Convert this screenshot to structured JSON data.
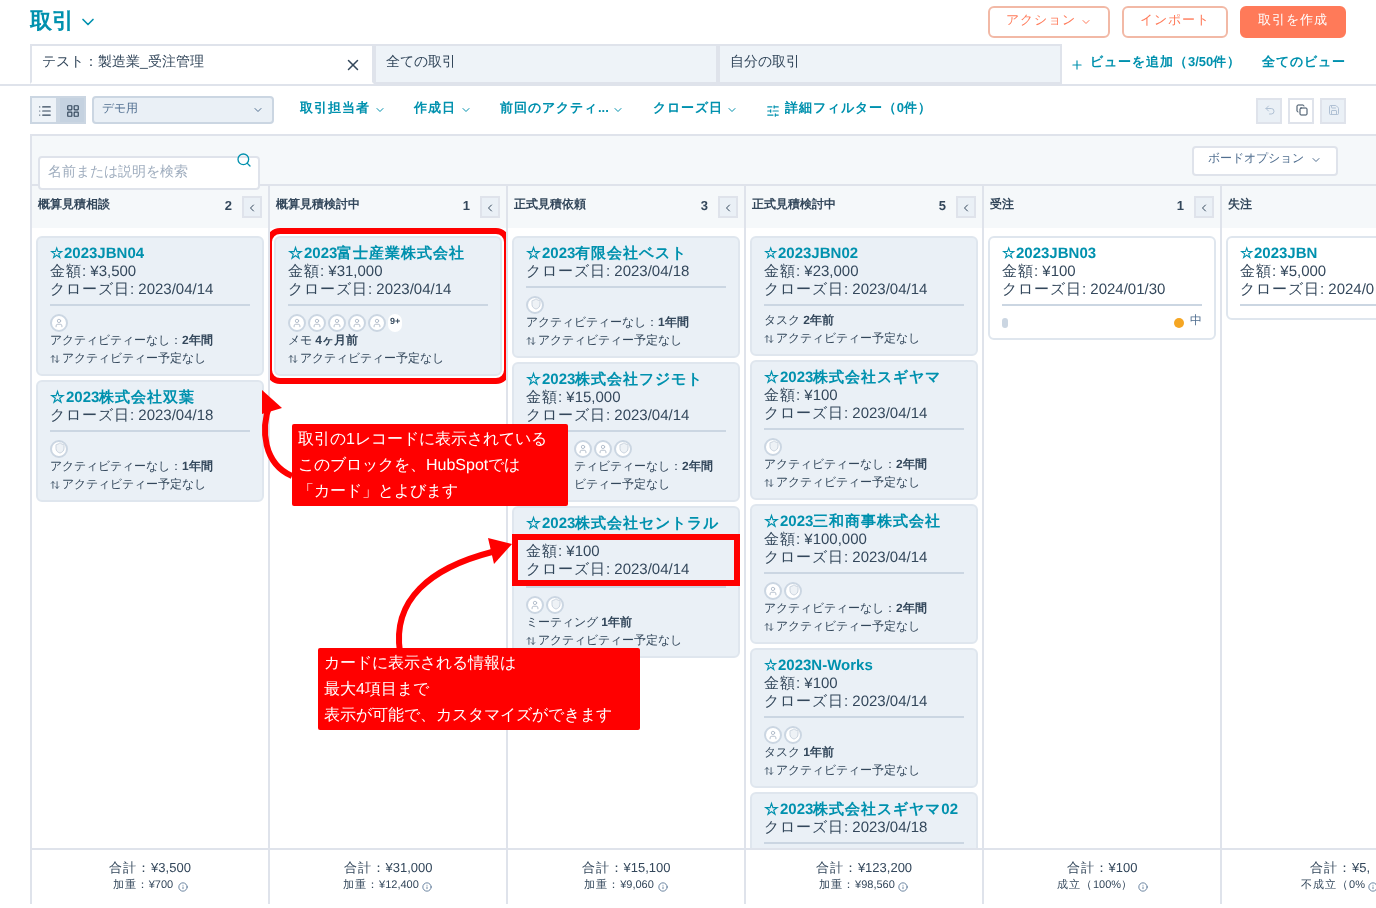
{
  "header": {
    "title": "取引",
    "buttons": [
      {
        "label": "アクション",
        "kind": "menu"
      },
      {
        "label": "インポート",
        "kind": "outline"
      },
      {
        "label": "取引を作成",
        "kind": "primary"
      }
    ]
  },
  "tabs": [
    {
      "label": "テスト：製造業_受注管理",
      "selected": true,
      "closable": true
    },
    {
      "label": "全ての取引",
      "selected": false,
      "closable": false
    },
    {
      "label": "自分の取引",
      "selected": false,
      "closable": false
    }
  ],
  "add_view": "ビューを追加（3/50件）",
  "all_views": "全てのビュー",
  "view_toggle": [
    {
      "kind": "list",
      "selected": false
    },
    {
      "kind": "grid",
      "selected": true
    }
  ],
  "pipeline": "デモ用",
  "filters": [
    {
      "label": "取引担当者",
      "kind": "dropdown"
    },
    {
      "label": "作成日",
      "kind": "dropdown"
    },
    {
      "label": "前回のアクティ...",
      "kind": "dropdown"
    },
    {
      "label": "クローズ日",
      "kind": "dropdown"
    },
    {
      "label": "詳細フィルター（0件）",
      "kind": "advanced"
    }
  ],
  "search": {
    "placeholder": "名前または説明を検索"
  },
  "board_options": "ボードオプション",
  "columns": [
    {
      "name": "概算見積相談",
      "count": "2",
      "total": "合計：¥3,500",
      "sub": "加重：¥700",
      "cards": [
        {
          "title": "☆2023JBN04",
          "lines": [
            "金額: ¥3,500",
            "クローズ日: 2023/04/14"
          ],
          "highlighted": true,
          "avatars": [
            {
              "kind": "person"
            }
          ],
          "activity": [
            {
              "kind": "text",
              "text": "アクティビティーなし：**2年間**"
            },
            {
              "kind": "upcoming",
              "text": "アクティビティー予定なし"
            }
          ]
        },
        {
          "title": "☆2023株式会社双葉",
          "lines": [
            "クローズ日: 2023/04/18"
          ],
          "highlighted": true,
          "avatars": [
            {
              "kind": "shield"
            }
          ],
          "activity": [
            {
              "kind": "text",
              "text": "アクティビティーなし：**1年間**"
            },
            {
              "kind": "upcoming",
              "text": "アクティビティー予定なし"
            }
          ]
        }
      ]
    },
    {
      "name": "概算見積検討中",
      "count": "1",
      "total": "合計：¥31,000",
      "sub": "加重：¥12,400",
      "cards": [
        {
          "title": "☆2023富士産業株式会社",
          "lines": [
            "金額: ¥31,000",
            "クローズ日: 2023/04/14"
          ],
          "highlighted": true,
          "outlined": true,
          "avatars": [
            {
              "kind": "person"
            },
            {
              "kind": "person"
            },
            {
              "kind": "person"
            },
            {
              "kind": "person"
            },
            {
              "kind": "person"
            }
          ],
          "more": "9+",
          "activity": [
            {
              "kind": "text",
              "text": "メモ **4ヶ月前**"
            },
            {
              "kind": "upcoming",
              "text": "アクティビティー予定なし"
            }
          ]
        }
      ]
    },
    {
      "name": "正式見積依頼",
      "count": "3",
      "total": "合計：¥15,100",
      "sub": "加重：¥9,060",
      "cards": [
        {
          "title": "☆2023有限会社ベスト",
          "lines": [
            "クローズ日: 2023/04/18"
          ],
          "highlighted": true,
          "avatars": [
            {
              "kind": "shield"
            }
          ],
          "activity": [
            {
              "kind": "text",
              "text": "アクティビティーなし：**1年間**"
            },
            {
              "kind": "upcoming",
              "text": "アクティビティー予定なし"
            }
          ]
        },
        {
          "title": "☆2023株式会社フジモト",
          "lines": [
            "金額: ¥15,000",
            "クローズ日: 2023/04/14"
          ],
          "highlighted": true,
          "covered": true,
          "avatars": [
            {
              "kind": "person"
            },
            {
              "kind": "person"
            },
            {
              "kind": "shield"
            }
          ],
          "activity": [
            {
              "kind": "text",
              "text": "ティビティーなし：**2年間**"
            },
            {
              "kind": "plain",
              "text": "ビティー予定なし"
            }
          ]
        },
        {
          "title": "☆2023株式会社セントラル",
          "lines": [
            "金額: ¥100",
            "クローズ日: 2023/04/14"
          ],
          "highlighted": true,
          "lines_outlined": true,
          "avatars": [
            {
              "kind": "person"
            },
            {
              "kind": "shield"
            }
          ],
          "activity": [
            {
              "kind": "text",
              "text": "ミーティング **1年前**"
            },
            {
              "kind": "upcoming",
              "text": "アクティビティー予定なし"
            }
          ]
        }
      ]
    },
    {
      "name": "正式見積検討中",
      "count": "5",
      "total": "合計：¥123,200",
      "sub": "加重：¥98,560",
      "cards": [
        {
          "title": "☆2023JBN02",
          "lines": [
            "金額: ¥23,000",
            "クローズ日: 2023/04/14"
          ],
          "highlighted": true,
          "activity": [
            {
              "kind": "text",
              "text": "タスク **2年前**"
            },
            {
              "kind": "upcoming",
              "text": "アクティビティー予定なし"
            }
          ]
        },
        {
          "title": "☆2023株式会社スギヤマ",
          "lines": [
            "金額: ¥100",
            "クローズ日: 2023/04/14"
          ],
          "highlighted": true,
          "avatars": [
            {
              "kind": "shield"
            }
          ],
          "activity": [
            {
              "kind": "text",
              "text": "アクティビティーなし：**2年間**"
            },
            {
              "kind": "upcoming",
              "text": "アクティビティー予定なし"
            }
          ]
        },
        {
          "title": "☆2023三和商事株式会社",
          "lines": [
            "金額: ¥100,000",
            "クローズ日: 2023/04/14"
          ],
          "highlighted": true,
          "avatars": [
            {
              "kind": "person"
            },
            {
              "kind": "shield"
            }
          ],
          "activity": [
            {
              "kind": "text",
              "text": "アクティビティーなし：**2年間**"
            },
            {
              "kind": "upcoming",
              "text": "アクティビティー予定なし"
            }
          ]
        },
        {
          "title": "☆2023N-Works",
          "lines": [
            "金額: ¥100",
            "クローズ日: 2023/04/14"
          ],
          "highlighted": true,
          "avatars": [
            {
              "kind": "person"
            },
            {
              "kind": "shield"
            }
          ],
          "activity": [
            {
              "kind": "text",
              "text": "タスク **1年前**"
            },
            {
              "kind": "upcoming",
              "text": "アクティビティー予定なし"
            }
          ]
        },
        {
          "title": "☆2023株式会社スギヤマ02",
          "lines": [
            "クローズ日: 2023/04/18"
          ],
          "highlighted": true
        }
      ]
    },
    {
      "name": "受注",
      "count": "1",
      "total": "合計：¥100",
      "sub": "成立（100%）",
      "cards": [
        {
          "title": "☆2023JBN03",
          "lines": [
            "金額: ¥100",
            "クローズ日: 2024/01/30"
          ],
          "highlighted": false,
          "avatars": [
            {
              "kind": "small"
            }
          ],
          "priority": {
            "label": "中",
            "color": "#f5a623"
          }
        }
      ]
    },
    {
      "name": "失注",
      "total": "合計：¥5,",
      "sub": "不成立（0%",
      "cards": [
        {
          "title": "☆2023JBN",
          "lines": [
            "金額: ¥5,000",
            "クローズ日: 2024/0"
          ],
          "highlighted": false
        }
      ]
    }
  ],
  "callouts": [
    {
      "lines": [
        "取引の1レコードに表示されている",
        "このブロックを、HubSpotでは",
        "「カード」とよびます"
      ]
    },
    {
      "lines": [
        "カードに表示される情報は",
        "最大4項目まで",
        "表示が可能で、カスタマイズができます"
      ]
    }
  ]
}
